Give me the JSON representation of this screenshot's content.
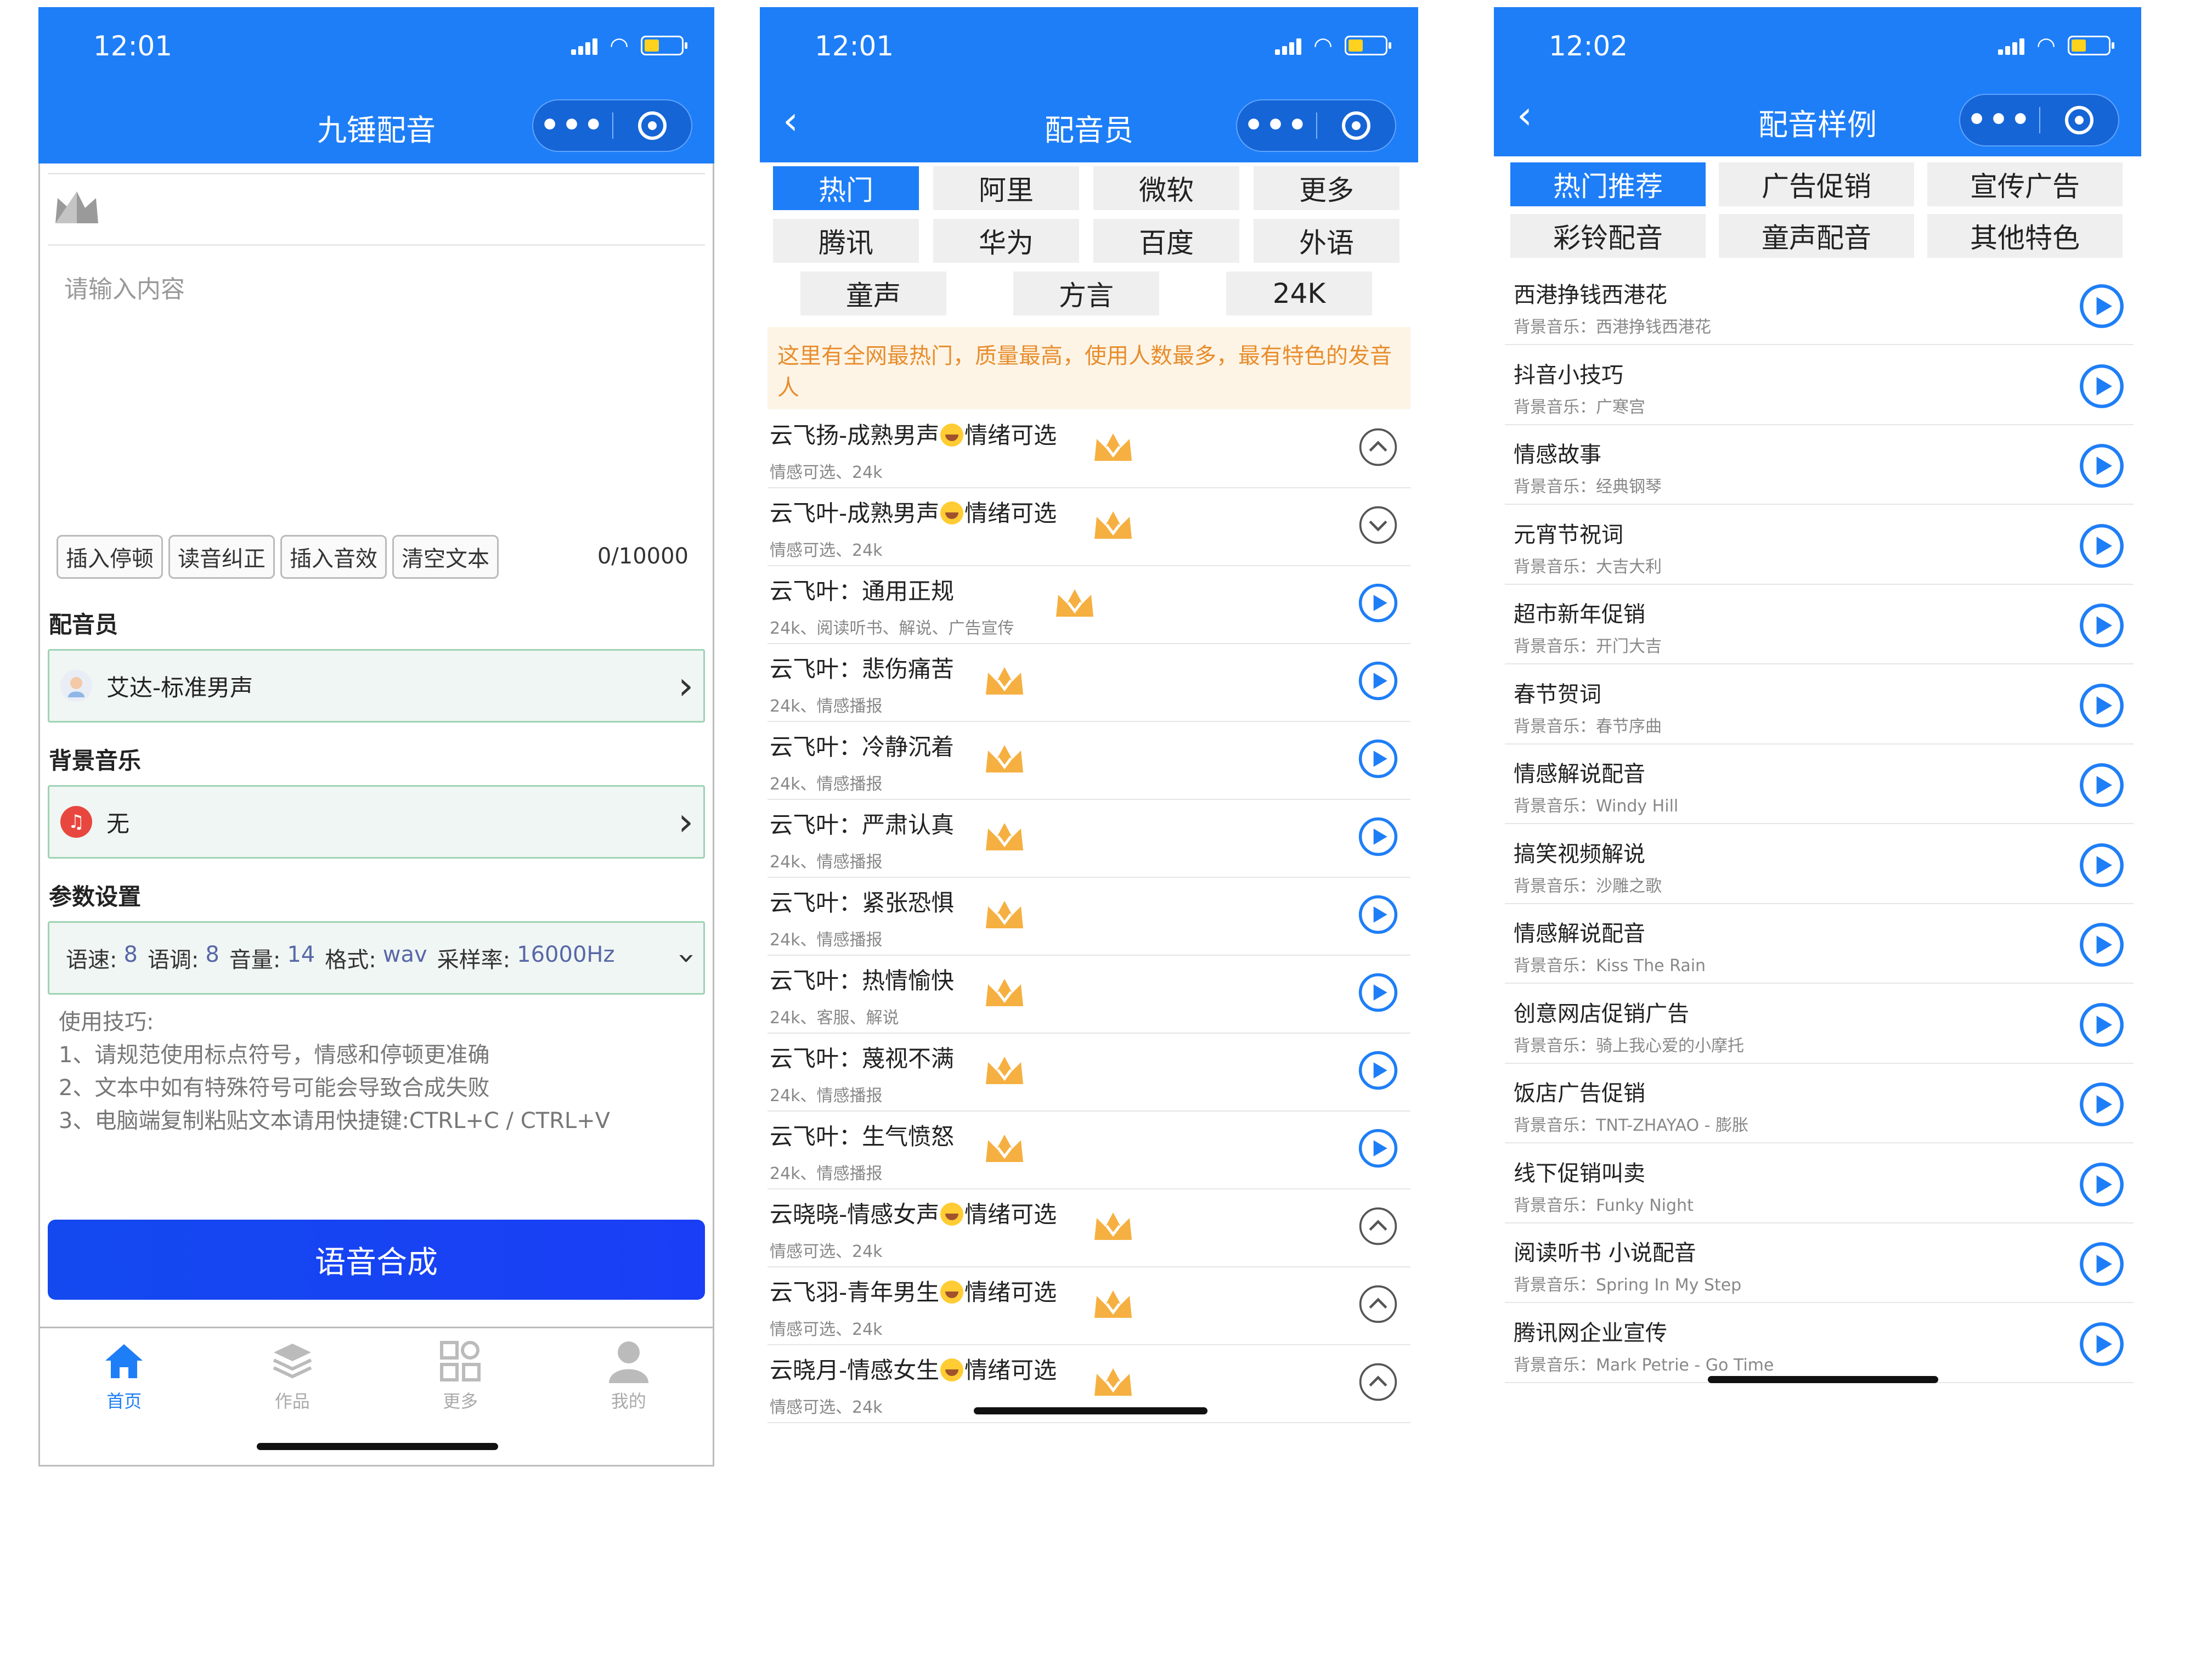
{
  "status": {
    "time1": "12:01",
    "time2": "12:01",
    "time3": "12:02"
  },
  "capsule": {
    "dots": "•••"
  },
  "home": {
    "title": "九锤配音",
    "placeholder": "请输入内容",
    "tools": [
      "插入停顿",
      "读音纠正",
      "插入音效",
      "清空文本"
    ],
    "counter": "0/10000",
    "voice_label": "配音员",
    "voice_value": "艾达-标准男声",
    "bgm_label": "背景音乐",
    "bgm_value": "无",
    "param_label": "参数设置",
    "params": {
      "speed_k": "语速:",
      "speed_v": "8",
      "pitch_k": "语调:",
      "pitch_v": "8",
      "vol_k": "音量:",
      "vol_v": "14",
      "fmt_k": "格式:",
      "fmt_v": "wav",
      "rate_k": "采样率:",
      "rate_v": "16000Hz"
    },
    "tips": [
      "使用技巧:",
      "1、请规范使用标点符号，情感和停顿更准确",
      "2、文本中如有特殊符号可能会导致合成失败",
      "3、电脑端复制粘贴文本请用快捷键:CTRL+C / CTRL+V"
    ],
    "synth_button": "语音合成",
    "tabs": [
      "首页",
      "作品",
      "更多",
      "我的"
    ]
  },
  "voices": {
    "title": "配音员",
    "categories": [
      "热门",
      "阿里",
      "微软",
      "更多",
      "腾讯",
      "华为",
      "百度",
      "外语",
      "童声",
      "方言",
      "24K"
    ],
    "notice": "这里有全网最热门，质量最高，使用人数最多，最有特色的发音人",
    "items": [
      {
        "name": "云飞扬-成熟男声",
        "emo": "情绪可选",
        "sub": "情感可选、24k",
        "btn": "chevron-up"
      },
      {
        "name": "云飞叶-成熟男声",
        "emo": "情绪可选",
        "sub": "情感可选、24k",
        "btn": "chevron-down"
      },
      {
        "name": "云飞叶：通用正规",
        "emo": "",
        "sub": "24k、阅读听书、解说、广告宣传",
        "btn": "play"
      },
      {
        "name": "云飞叶：悲伤痛苦",
        "emo": "",
        "sub": "24k、情感播报",
        "btn": "play"
      },
      {
        "name": "云飞叶：冷静沉着",
        "emo": "",
        "sub": "24k、情感播报",
        "btn": "play"
      },
      {
        "name": "云飞叶：严肃认真",
        "emo": "",
        "sub": "24k、情感播报",
        "btn": "play"
      },
      {
        "name": "云飞叶：紧张恐惧",
        "emo": "",
        "sub": "24k、情感播报",
        "btn": "play"
      },
      {
        "name": "云飞叶：热情愉快",
        "emo": "",
        "sub": "24k、客服、解说",
        "btn": "play"
      },
      {
        "name": "云飞叶：蔑视不满",
        "emo": "",
        "sub": "24k、情感播报",
        "btn": "play"
      },
      {
        "name": "云飞叶：生气愤怒",
        "emo": "",
        "sub": "24k、情感播报",
        "btn": "play"
      },
      {
        "name": "云晓晓-情感女声",
        "emo": "情绪可选",
        "sub": "情感可选、24k",
        "btn": "chevron-up"
      },
      {
        "name": "云飞羽-青年男生",
        "emo": "情绪可选",
        "sub": "情感可选、24k",
        "btn": "chevron-up"
      },
      {
        "name": "云晓月-情感女生",
        "emo": "情绪可选",
        "sub": "情感可选、24k",
        "btn": "chevron-up"
      }
    ]
  },
  "samples": {
    "title": "配音样例",
    "categories": [
      "热门推荐",
      "广告促销",
      "宣传广告",
      "彩铃配音",
      "童声配音",
      "其他特色"
    ],
    "items": [
      {
        "name": "西港挣钱西港花",
        "sub": "背景音乐：西港挣钱西港花"
      },
      {
        "name": "抖音小技巧",
        "sub": "背景音乐：广寒宫"
      },
      {
        "name": "情感故事",
        "sub": "背景音乐：经典钢琴"
      },
      {
        "name": "元宵节祝词",
        "sub": "背景音乐：大吉大利"
      },
      {
        "name": "超市新年促销",
        "sub": "背景音乐：开门大吉"
      },
      {
        "name": "春节贺词",
        "sub": "背景音乐：春节序曲"
      },
      {
        "name": "情感解说配音",
        "sub": "背景音乐：Windy Hill"
      },
      {
        "name": "搞笑视频解说",
        "sub": "背景音乐：沙雕之歌"
      },
      {
        "name": "情感解说配音",
        "sub": "背景音乐：Kiss The Rain"
      },
      {
        "name": "创意网店促销广告",
        "sub": "背景音乐：骑上我心爱的小摩托"
      },
      {
        "name": "饭店广告促销",
        "sub": "背景音乐：TNT-ZHAYAO - 膨胀"
      },
      {
        "name": "线下促销叫卖",
        "sub": "背景音乐：Funky Night"
      },
      {
        "name": "阅读听书 小说配音",
        "sub": "背景音乐：Spring In My Step"
      },
      {
        "name": "腾讯网企业宣传",
        "sub": "背景音乐：Mark Petrie - Go Time"
      }
    ]
  },
  "colors": {
    "accent": "#1e7ef7",
    "crown": "#f5b041",
    "notice_text": "#e88d2c"
  }
}
